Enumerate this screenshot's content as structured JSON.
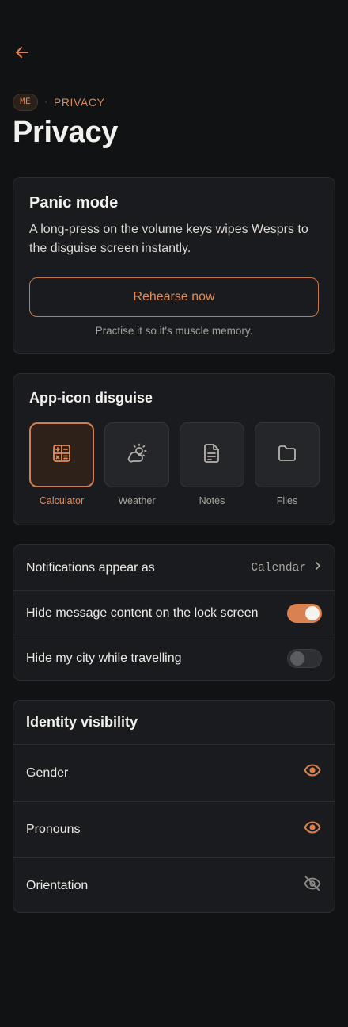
{
  "header": {
    "breadcrumb_badge": "ME",
    "breadcrumb_separator": "·",
    "breadcrumb_label": "PRIVACY",
    "title": "Privacy"
  },
  "panic": {
    "title": "Panic mode",
    "description": "A long-press on the volume keys wipes Wesprs to the disguise screen instantly.",
    "button_label": "Rehearse now",
    "hint": "Practise it so it's muscle memory."
  },
  "disguise": {
    "title": "App-icon disguise",
    "options": [
      {
        "label": "Calculator",
        "icon": "calculator-icon",
        "selected": true
      },
      {
        "label": "Weather",
        "icon": "weather-icon",
        "selected": false
      },
      {
        "label": "Notes",
        "icon": "notes-icon",
        "selected": false
      },
      {
        "label": "Files",
        "icon": "folder-icon",
        "selected": false
      }
    ]
  },
  "settings": {
    "notifications_label": "Notifications appear as",
    "notifications_value": "Calendar",
    "hide_content_label": "Hide message content on the lock screen",
    "hide_content_on": true,
    "hide_city_label": "Hide my city while travelling",
    "hide_city_on": false
  },
  "identity": {
    "title": "Identity visibility",
    "rows": [
      {
        "label": "Gender",
        "visible": true
      },
      {
        "label": "Pronouns",
        "visible": true
      },
      {
        "label": "Orientation",
        "visible": false
      }
    ]
  },
  "colors": {
    "accent": "#D98150",
    "background": "#111214",
    "card": "#1A1B1E"
  }
}
